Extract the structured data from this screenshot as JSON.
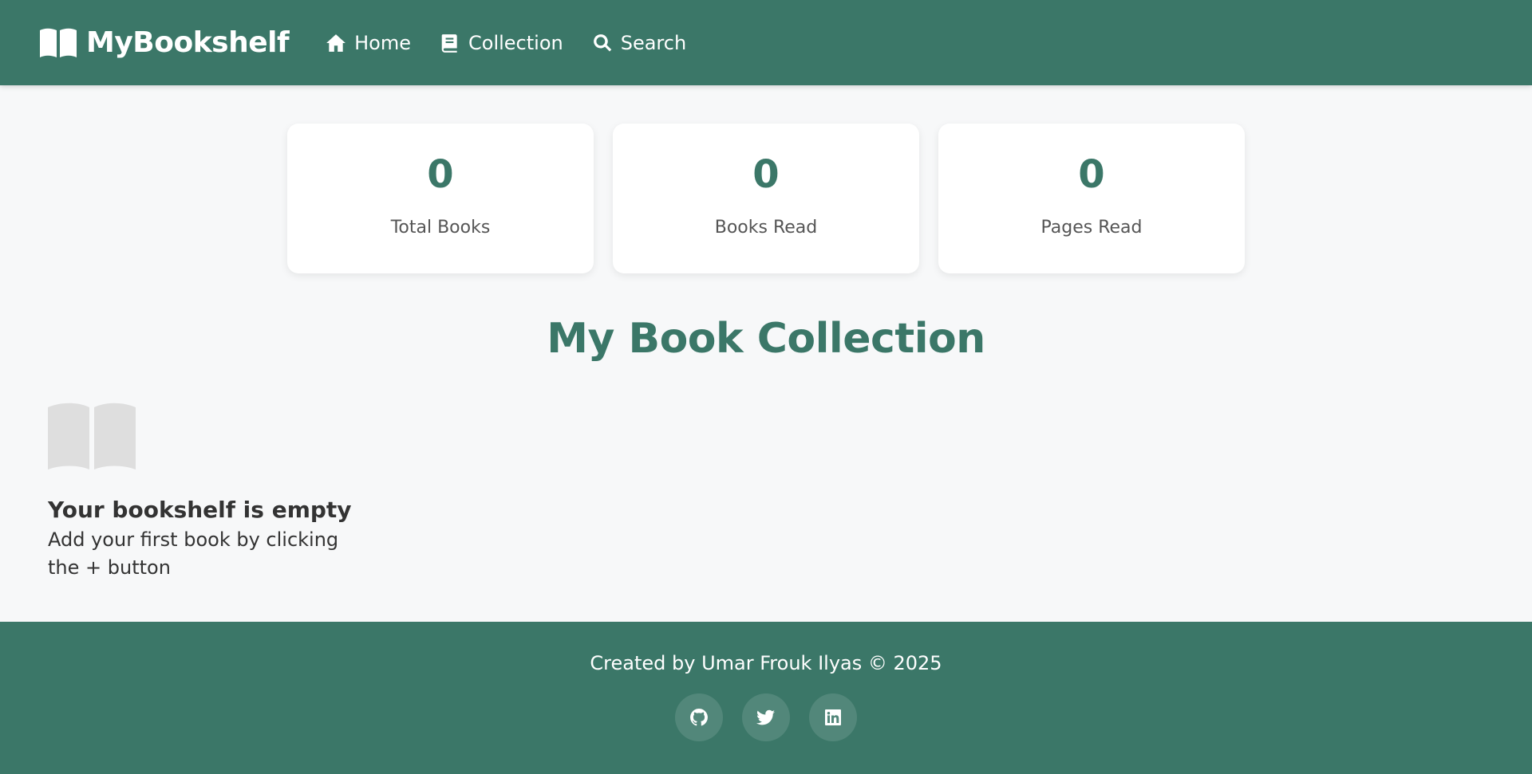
{
  "brand": {
    "name": "MyBookshelf",
    "icon": "book-open-icon"
  },
  "nav": {
    "items": [
      {
        "label": "Home",
        "icon": "home-icon"
      },
      {
        "label": "Collection",
        "icon": "book-icon"
      },
      {
        "label": "Search",
        "icon": "search-icon"
      }
    ]
  },
  "stats": [
    {
      "value": "0",
      "label": "Total Books"
    },
    {
      "value": "0",
      "label": "Books Read"
    },
    {
      "value": "0",
      "label": "Pages Read"
    }
  ],
  "collection": {
    "title": "My Book Collection",
    "empty_icon": "book-open-icon",
    "empty_title": "Your bookshelf is empty",
    "empty_text": "Add your first book by clicking the + button"
  },
  "footer": {
    "credit": "Created by Umar Frouk Ilyas © 2025",
    "socials": [
      {
        "icon": "github-icon"
      },
      {
        "icon": "twitter-icon"
      },
      {
        "icon": "linkedin-icon"
      }
    ]
  },
  "colors": {
    "primary": "#3b7768",
    "background": "#f7f8f9",
    "card": "#ffffff",
    "empty_icon": "#dedede"
  }
}
